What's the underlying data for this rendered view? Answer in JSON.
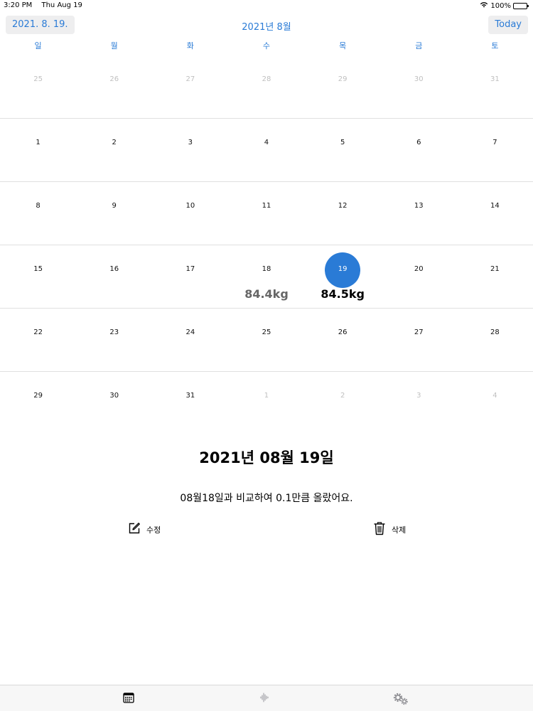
{
  "status_bar": {
    "time": "3:20 PM",
    "date": "Thu Aug 19",
    "battery": "100%"
  },
  "nav": {
    "selected_date_label": "2021. 8. 19.",
    "month_title": "2021년 8월",
    "today_label": "Today"
  },
  "weekdays": [
    "일",
    "월",
    "화",
    "수",
    "목",
    "금",
    "토"
  ],
  "calendar": {
    "weeks": [
      [
        {
          "d": "25",
          "other": true
        },
        {
          "d": "26",
          "other": true
        },
        {
          "d": "27",
          "other": true
        },
        {
          "d": "28",
          "other": true
        },
        {
          "d": "29",
          "other": true
        },
        {
          "d": "30",
          "other": true
        },
        {
          "d": "31",
          "other": true
        }
      ],
      [
        {
          "d": "1"
        },
        {
          "d": "2"
        },
        {
          "d": "3"
        },
        {
          "d": "4"
        },
        {
          "d": "5"
        },
        {
          "d": "6"
        },
        {
          "d": "7"
        }
      ],
      [
        {
          "d": "8"
        },
        {
          "d": "9"
        },
        {
          "d": "10"
        },
        {
          "d": "11"
        },
        {
          "d": "12"
        },
        {
          "d": "13"
        },
        {
          "d": "14"
        }
      ],
      [
        {
          "d": "15"
        },
        {
          "d": "16"
        },
        {
          "d": "17"
        },
        {
          "d": "18",
          "weight": "84.4kg"
        },
        {
          "d": "19",
          "weight": "84.5kg",
          "selected": true
        },
        {
          "d": "20"
        },
        {
          "d": "21"
        }
      ],
      [
        {
          "d": "22"
        },
        {
          "d": "23"
        },
        {
          "d": "24"
        },
        {
          "d": "25"
        },
        {
          "d": "26"
        },
        {
          "d": "27"
        },
        {
          "d": "28"
        }
      ],
      [
        {
          "d": "29"
        },
        {
          "d": "30"
        },
        {
          "d": "31"
        },
        {
          "d": "1",
          "other": true
        },
        {
          "d": "2",
          "other": true
        },
        {
          "d": "3",
          "other": true
        },
        {
          "d": "4",
          "other": true
        }
      ]
    ]
  },
  "detail": {
    "date": "2021년 08월 19일",
    "message": "08월18일과 비교하여 0.1만큼 올랐어요.",
    "edit_label": "수정",
    "delete_label": "삭제"
  },
  "tabs": [
    {
      "icon": "calendar-icon"
    },
    {
      "icon": "waveform-icon"
    },
    {
      "icon": "gears-icon"
    }
  ],
  "colors": {
    "accent": "#2a7bd6",
    "other_month_text": "#c0c0c0",
    "tab_inactive": "#8e8e93"
  }
}
